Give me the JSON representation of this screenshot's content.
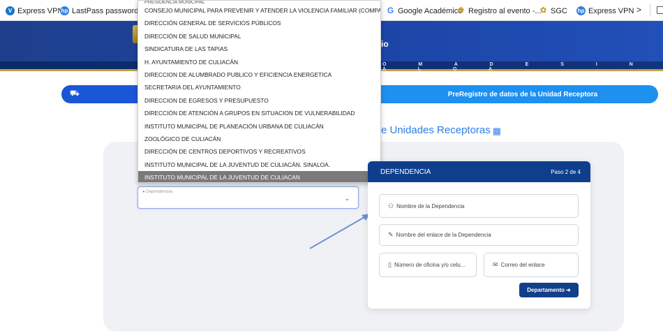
{
  "bookmarks": {
    "left": [
      {
        "icon": "express-vpn-icon",
        "label": "Express VPN"
      },
      {
        "icon": "lastpass-icon",
        "label": "LastPass password..."
      }
    ],
    "right": [
      {
        "icon": "google-icon",
        "label": "Google Académico"
      },
      {
        "icon": "registro-icon",
        "label": "Registro al evento -..."
      },
      {
        "icon": "sgc-icon",
        "label": "SGC"
      },
      {
        "icon": "express-vpn-icon",
        "label": "Express VPN"
      }
    ],
    "more": ">"
  },
  "header": {
    "title_fragment": "io",
    "subbar_text": "O M A   D E   S I N A L O A"
  },
  "nav": {
    "right_label": "PreRegistro de datos de la Unidad Receptora"
  },
  "section_title": "e Unidades Receptoras",
  "dropdown": {
    "items": [
      "PRESIDENCIA MUNICIPAL",
      "CONSEJO MUNICIPAL PARA PREVENIR Y ATENDER LA VIOLENCIA FAMILIAR (COMPAVIF)",
      "DIRECCIÓN GENERAL DE SERVICIOS PÚBLICOS",
      "DIRECCIÓN DE SALUD MUNICIPAL",
      "SINDICATURA DE LAS TAPIAS",
      "H. AYUNTAMIENTO DE CULIACÁN",
      "DIRECCION DE ALUMBRADO PUBLICO Y EFICIENCIA ENERGETICA",
      "SECRETARIA DEL AYUNTAMIENTO",
      "DIRECCION DE EGRESOS Y PRESUPUESTO",
      "DIRECCIÓN DE ATENCIÓN A GRUPOS EN SITUACION DE VULNERABILIDAD",
      "INSTITUTO MUNICIPAL DE PLANEACIÓN URBANA DE CULIACÁN",
      "ZOOLÓGICO DE CULIACÁN",
      "DIRECCIÓN DE CENTROS DEPORTIVOS Y RECREATIVOS",
      "INSTITUTO MUNICIPAL DE LA JUVENTUD DE CULIACÁN. SINALOA.",
      "INSTITUTO MUNICIPAL DE LA JUVENTUD DE CULIACAN"
    ],
    "selected_index": 14
  },
  "select": {
    "label": "Dependencias"
  },
  "card": {
    "title": "DEPENDENCIA",
    "step": "Paso 2 de 4",
    "fields": {
      "nombre_dependencia": "Nombre de la Dependencia",
      "nombre_enlace": "Nombre del enlace de la Dependencia",
      "numero_oficina": "Número de oficina y/o celu...",
      "correo_enlace": "Correo del enlace"
    },
    "button_label": "Departamento"
  },
  "colors": {
    "banner": "#1c44a6",
    "card_header": "#0f3f8c",
    "nav_right": "#1e90f0",
    "accent_text": "#2d7ee6",
    "selected_row": "#7a7a7a"
  }
}
